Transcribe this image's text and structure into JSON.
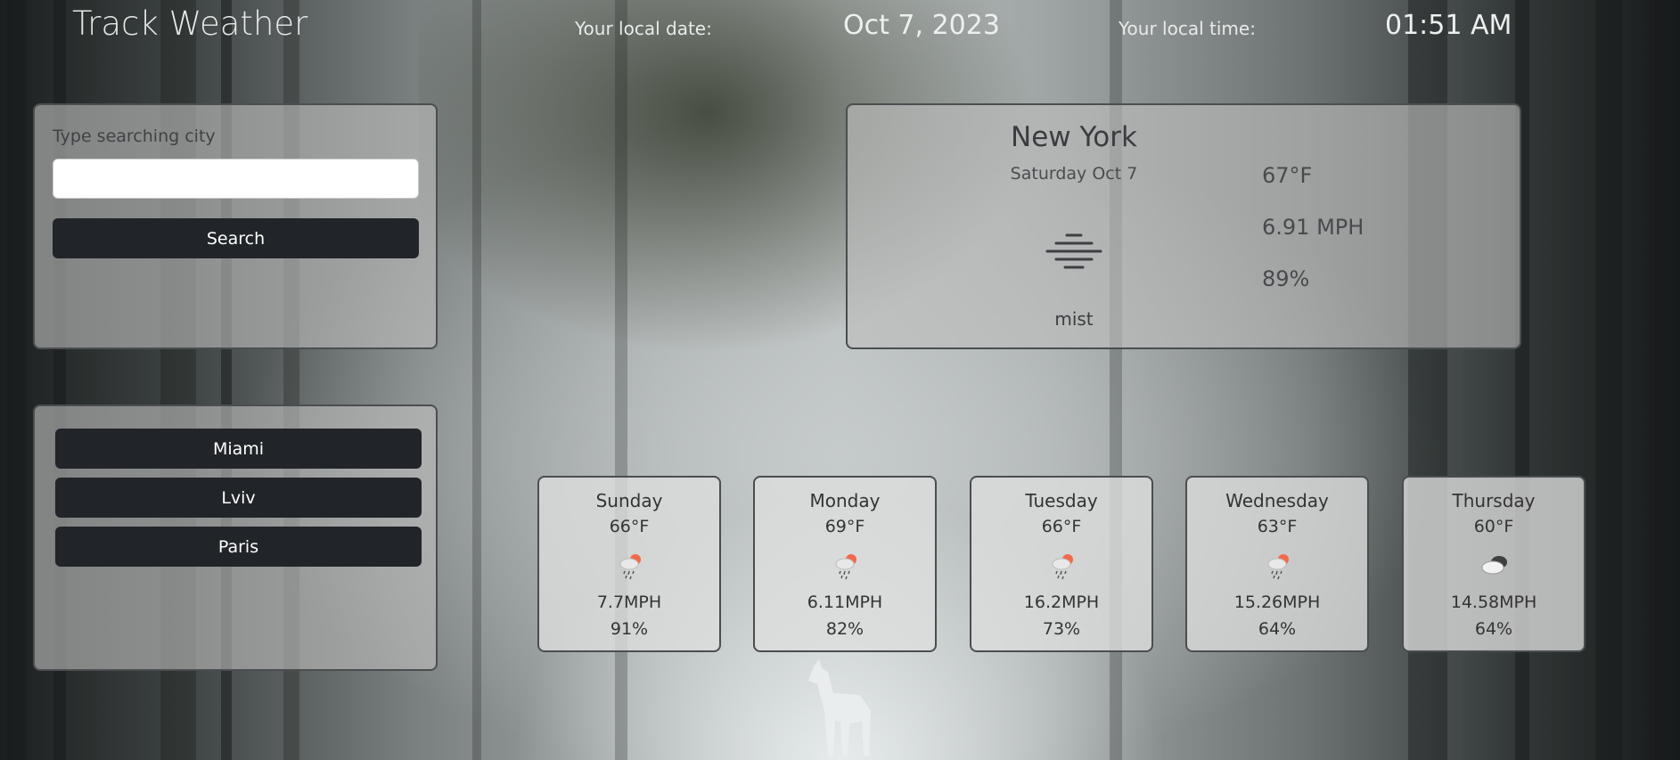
{
  "header": {
    "title": "Track Weather",
    "date_label": "Your local date:",
    "date_value": "Oct 7, 2023",
    "time_label": "Your local time:",
    "time_value": "01:51 AM"
  },
  "search": {
    "label": "Type searching city",
    "value": "",
    "placeholder": "",
    "button": "Search"
  },
  "saved_cities": [
    "Miami",
    "Lviv",
    "Paris"
  ],
  "current": {
    "city": "New York",
    "date": "Saturday Oct 7",
    "description": "mist",
    "icon": "mist-icon",
    "temperature": "67°F",
    "wind": "6.91 MPH",
    "humidity": "89%"
  },
  "forecast": [
    {
      "day": "Sunday",
      "temp": "66°F",
      "wind": "7.7MPH",
      "humidity": "91%",
      "icon": "rain-sun-icon"
    },
    {
      "day": "Monday",
      "temp": "69°F",
      "wind": "6.11MPH",
      "humidity": "82%",
      "icon": "rain-sun-icon"
    },
    {
      "day": "Tuesday",
      "temp": "66°F",
      "wind": "16.2MPH",
      "humidity": "73%",
      "icon": "rain-sun-icon"
    },
    {
      "day": "Wednesday",
      "temp": "63°F",
      "wind": "15.26MPH",
      "humidity": "64%",
      "icon": "rain-sun-icon"
    },
    {
      "day": "Thursday",
      "temp": "60°F",
      "wind": "14.58MPH",
      "humidity": "64%",
      "icon": "cloudy-icon"
    }
  ],
  "colors": {
    "button": "#212529",
    "panel": "#bebebe",
    "sun": "#f26a4b"
  }
}
